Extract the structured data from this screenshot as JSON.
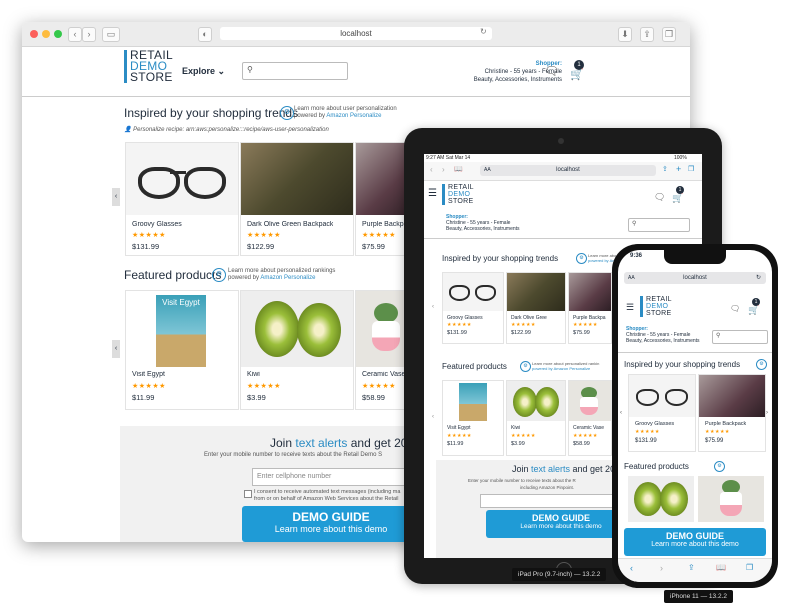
{
  "browser": {
    "url": "localhost",
    "logo": [
      "RETAIL",
      "DEMO",
      "STORE"
    ],
    "explore_label": "Explore",
    "shopper_label": "Shopper:",
    "shopper_detail": "Christine - 55 years - Female",
    "shopper_interests": "Beauty, Accessories, Instruments",
    "cart_count": "1",
    "trending_title": "Inspired by your shopping trends",
    "learn_more_user": "Learn more about user personalization",
    "powered_by": "powered by",
    "amazon_personalize": "Amazon Personalize",
    "recipe": "Personalize recipe: arn:aws:personalize:::recipe/aws-user-personalization",
    "trending_products": [
      {
        "name": "Groovy Glasses",
        "price": "$131.99"
      },
      {
        "name": "Dark Olive Green Backpack",
        "price": "$122.99"
      },
      {
        "name": "Purple Backpack",
        "price": "$75.99"
      }
    ],
    "featured_title": "Featured products",
    "learn_more_rankings": "Learn more about personalized rankings",
    "featured_products": [
      {
        "name": "Visit Egypt",
        "price": "$11.99",
        "cover_text": "Visit Egypt"
      },
      {
        "name": "Kiwi",
        "price": "$3.99"
      },
      {
        "name": "Ceramic Vase",
        "price": "$58.99"
      }
    ],
    "join_prefix": "Join ",
    "join_link": "text alerts",
    "join_suffix": " and get 20",
    "join_sub": "Enter your mobile number to receive texts about the Retail Demo S",
    "phone_placeholder": "Enter cellphone number",
    "consent_1": "I consent to receive automated text messages (including ma",
    "consent_2": "from or on behalf of Amazon Web Services about the Retail",
    "demo_guide_title": "DEMO GUIDE",
    "demo_guide_sub": "Learn more about this demo"
  },
  "ipad": {
    "status_time": "9:27 AM",
    "status_date": "Sat Mar 14",
    "status_battery": "100%",
    "url_prefix": "AA",
    "url": "localhost",
    "cart_count": "1",
    "shopper_label": "Shopper:",
    "shopper_detail": "Christine - 55 years - Female",
    "shopper_interests": "Beauty, Accessories, Instruments",
    "trending_title": "Inspired by your shopping trends",
    "learn_more_user": "Learn more about user personalization",
    "powered_by": "powered by Amazon Personalize",
    "trending_products": [
      {
        "name": "Groovy Glasses",
        "price": "$131.99"
      },
      {
        "name": "Dark Olive Gree",
        "price": "$122.99"
      },
      {
        "name": "Purple Backpa",
        "price": "$75.99"
      }
    ],
    "featured_title": "Featured products",
    "learn_more_rankings": "Learn more about personalized rankin",
    "featured_products": [
      {
        "name": "Visit Egypt",
        "price": "$11.99"
      },
      {
        "name": "Kiwi",
        "price": "$3.99"
      },
      {
        "name": "Ceramic Vase",
        "price": "$58.99"
      }
    ],
    "join_prefix": "Join ",
    "join_link": "text alerts",
    "join_suffix": " and get 20",
    "join_sub": "Enter your mobile number to receive texts about the R",
    "join_sub2": "including Amazon Pinpoint.",
    "demo_guide_title": "DEMO GUIDE",
    "demo_guide_sub": "Learn more about this demo",
    "device_label": "iPad Pro (9.7-inch) — 13.2.2"
  },
  "iphone": {
    "status_time": "9:36",
    "url_prefix": "AA",
    "url": "localhost",
    "cart_count": "1",
    "shopper_label": "Shopper:",
    "shopper_detail": "Christine - 55 years - Female",
    "shopper_interests": "Beauty, Accessories, Instruments",
    "trending_title": "Inspired by your shopping trends",
    "trending_products": [
      {
        "name": "Groovy Glasses",
        "price": "$131.99"
      },
      {
        "name": "Purple Backpack",
        "price": "$75.99"
      }
    ],
    "featured_title": "Featured products",
    "demo_guide_title": "DEMO GUIDE",
    "demo_guide_sub": "Learn more about this demo",
    "device_label": "iPhone 11 — 13.2.2"
  },
  "colors": {
    "accent": "#2b8cc4",
    "star": "#ff9900",
    "demo_guide": "#1f9bd6",
    "text": "#232f3e"
  }
}
